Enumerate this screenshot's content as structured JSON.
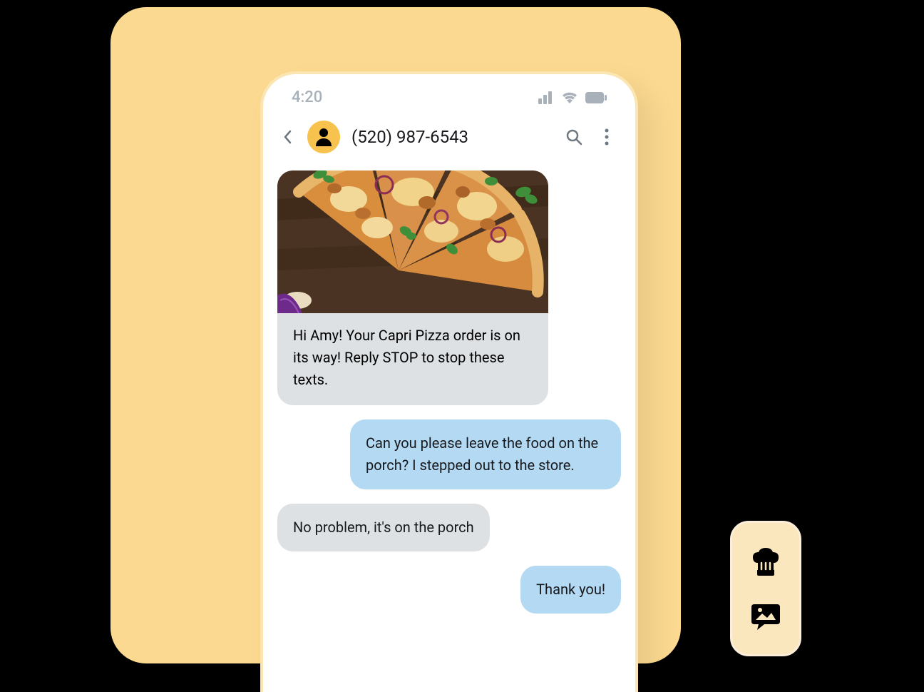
{
  "status_bar": {
    "time": "4:20",
    "signal_icon": "signal-icon",
    "wifi_icon": "wifi-icon",
    "battery_icon": "battery-icon"
  },
  "chat_header": {
    "back_icon": "chevron-left-icon",
    "avatar_icon": "person-icon",
    "contact": "(520) 987-6543",
    "search_icon": "search-icon",
    "more_icon": "more-vert-icon"
  },
  "messages": [
    {
      "direction": "in",
      "has_image": true,
      "image_alt": "pizza-photo",
      "text": "Hi Amy! Your Capri Pizza order is on its way! Reply STOP to stop these texts."
    },
    {
      "direction": "out",
      "text": "Can you please leave the food on the porch? I stepped out to the store."
    },
    {
      "direction": "in",
      "text": "No problem, it's on the porch"
    },
    {
      "direction": "out",
      "text": "Thank you!"
    }
  ],
  "float_panel": {
    "icon1": "chef-hat-icon",
    "icon2": "image-chat-icon"
  }
}
